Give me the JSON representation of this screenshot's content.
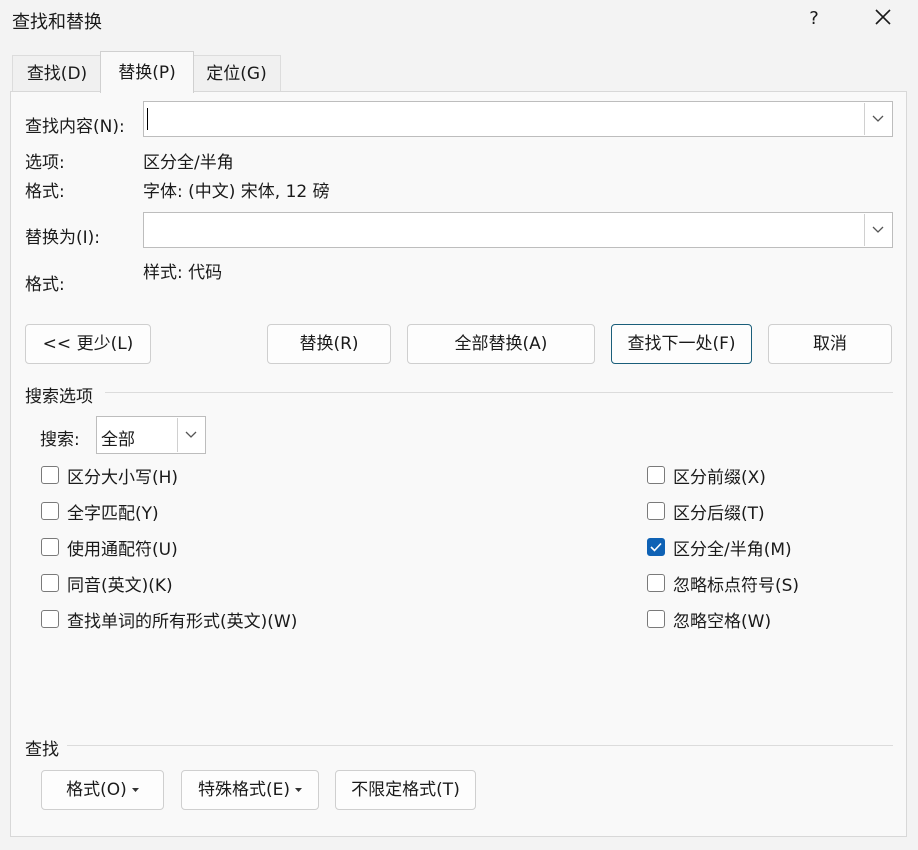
{
  "window": {
    "title": "查找和替换",
    "help_label": "?",
    "close_icon": "close-icon"
  },
  "tabs": [
    {
      "label": "查找(D)",
      "active": false
    },
    {
      "label": "替换(P)",
      "active": true
    },
    {
      "label": "定位(G)",
      "active": false
    }
  ],
  "find": {
    "label": "查找内容(N):",
    "value": "",
    "options_label": "选项:",
    "options_value": "区分全/半角",
    "format_label": "格式:",
    "format_value": "字体: (中文) 宋体, 12 磅"
  },
  "replace": {
    "label": "替换为(I):",
    "value": "",
    "format_label": "格式:",
    "format_value": "样式: 代码"
  },
  "buttons": {
    "less": "<< 更少(L)",
    "replace": "替换(R)",
    "replace_all": "全部替换(A)",
    "find_next": "查找下一处(F)",
    "cancel": "取消"
  },
  "search_options": {
    "title": "搜索选项",
    "search_label": "搜索:",
    "search_value": "全部",
    "left_checks": [
      {
        "label": "区分大小写(H)",
        "checked": false
      },
      {
        "label": "全字匹配(Y)",
        "checked": false
      },
      {
        "label": "使用通配符(U)",
        "checked": false
      },
      {
        "label": "同音(英文)(K)",
        "checked": false
      },
      {
        "label": "查找单词的所有形式(英文)(W)",
        "checked": false
      }
    ],
    "right_checks": [
      {
        "label": "区分前缀(X)",
        "checked": false
      },
      {
        "label": "区分后缀(T)",
        "checked": false
      },
      {
        "label": "区分全/半角(M)",
        "checked": true
      },
      {
        "label": "忽略标点符号(S)",
        "checked": false
      },
      {
        "label": "忽略空格(W)",
        "checked": false
      }
    ]
  },
  "find_section": {
    "title": "查找",
    "format_btn": "格式(O)",
    "special_btn": "特殊格式(E)",
    "no_format_btn": "不限定格式(T)"
  },
  "colors": {
    "accent": "#0f62b5",
    "default_border": "#1a5e7a"
  }
}
